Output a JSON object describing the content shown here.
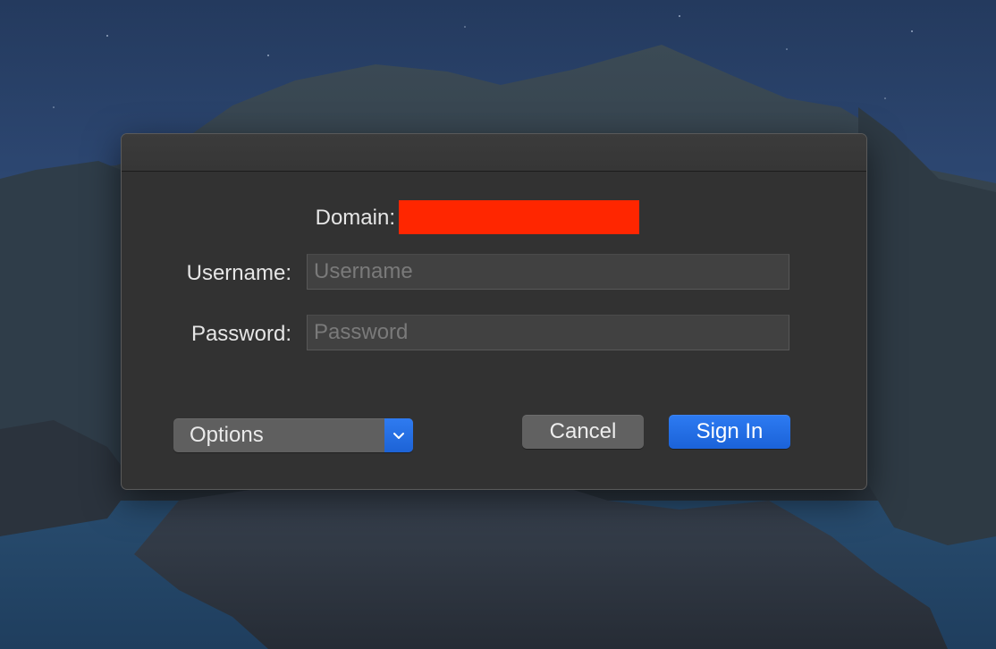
{
  "dialog": {
    "domain_label": "Domain:",
    "username_label": "Username:",
    "username_placeholder": "Username",
    "username_value": "",
    "password_label": "Password:",
    "password_placeholder": "Password",
    "password_value": ""
  },
  "options": {
    "selected": "Options",
    "arrow_icon": "chevron-down-icon"
  },
  "buttons": {
    "cancel_label": "Cancel",
    "signin_label": "Sign In"
  },
  "colors": {
    "accent": "#1f6de0",
    "redaction": "#ff2600",
    "dialog_bg": "#323232"
  }
}
